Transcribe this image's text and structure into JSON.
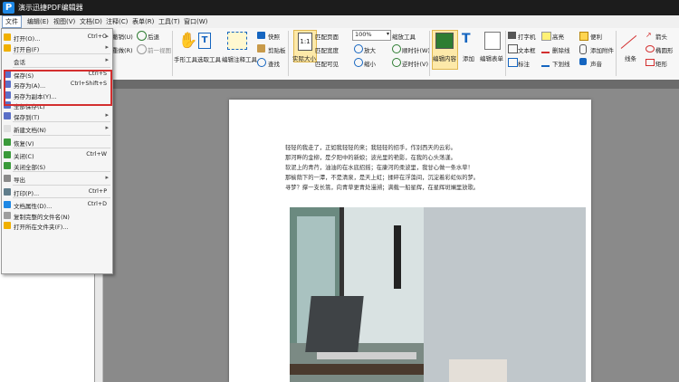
{
  "titlebar": {
    "logo": "P",
    "title": "演示迅捷PDF编辑器"
  },
  "menubar": [
    "文件",
    "编辑(E)",
    "视图(V)",
    "文档(D)",
    "注释(C)",
    "表单(R)",
    "工具(T)",
    "窗口(W)"
  ],
  "ribbon": {
    "undo": "撤销(U)",
    "redo": "重做(R)",
    "back": "后退",
    "prev_view": "前一视图",
    "hand": "手形工具",
    "select": "选取工具",
    "edit_annot": "编辑注释工具",
    "snapshot": "快照",
    "clipboard": "剪贴板",
    "find": "查找",
    "actual_size": "实际大小",
    "fit_page": "匹配页面",
    "fit_width": "匹配宽度",
    "fit_visible": "匹配可见",
    "zoom_value": "100%",
    "zoom_tool": "缩放工具",
    "zoom_in": "放大",
    "zoom_out": "缩小",
    "rotate_cw": "顺时针(W)",
    "rotate_ccw": "逆时针(V)",
    "edit_content": "编辑内容",
    "add": "添加",
    "edit_form": "编辑表单",
    "typewriter": "打字机",
    "textbox": "文本框",
    "callout": "标注",
    "highlight": "高亮",
    "strike": "删除线",
    "underline": "下划线",
    "note": "便利",
    "attach": "添加附件",
    "sound": "声音",
    "line": "线条",
    "arrow": "箭头",
    "ellipse": "椭圆形",
    "rect": "矩形"
  },
  "file_menu": [
    {
      "label": "打开(O)...",
      "shortcut": "Ctrl+O",
      "arrow": "▸",
      "icon": "#f0b000"
    },
    {
      "label": "打开自(F)",
      "shortcut": "",
      "arrow": "▸",
      "icon": "#f0b000"
    },
    {
      "sep": true
    },
    {
      "label": "会话",
      "shortcut": "",
      "arrow": "▸",
      "icon": ""
    },
    {
      "sep": true
    },
    {
      "label": "保存(S)",
      "shortcut": "Ctrl+S",
      "arrow": "",
      "icon": "#5b6fc7"
    },
    {
      "label": "另存为(A)...",
      "shortcut": "Ctrl+Shift+S",
      "arrow": "",
      "icon": "#5b6fc7"
    },
    {
      "label": "另存为副本(Y)...",
      "shortcut": "",
      "arrow": "",
      "icon": "#5b6fc7"
    },
    {
      "label": "全部保存(L)",
      "shortcut": "",
      "arrow": "",
      "icon": "#5b6fc7"
    },
    {
      "label": "保存到(T)",
      "shortcut": "",
      "arrow": "▸",
      "icon": "#5b6fc7"
    },
    {
      "sep": true
    },
    {
      "label": "新建文档(N)",
      "shortcut": "",
      "arrow": "▸",
      "icon": "#e0e0e0"
    },
    {
      "sep": true
    },
    {
      "label": "恢复(V)",
      "shortcut": "",
      "arrow": "",
      "icon": "#3a9a3a"
    },
    {
      "sep": true
    },
    {
      "label": "关闭(C)",
      "shortcut": "Ctrl+W",
      "arrow": "",
      "icon": "#3a9a3a"
    },
    {
      "label": "关闭全部(S)",
      "shortcut": "",
      "arrow": "",
      "icon": "#3a9a3a"
    },
    {
      "sep": true
    },
    {
      "label": "导出",
      "shortcut": "",
      "arrow": "▸",
      "icon": "#8a8a8a"
    },
    {
      "sep": true
    },
    {
      "label": "打印(P)...",
      "shortcut": "Ctrl+P",
      "arrow": "",
      "icon": "#607d8b"
    },
    {
      "sep": true
    },
    {
      "label": "文档属性(D)...",
      "shortcut": "Ctrl+D",
      "arrow": "",
      "icon": "#1e88e5"
    },
    {
      "label": "复制完整的文件名(N)",
      "shortcut": "",
      "arrow": "",
      "icon": "#9e9e9e"
    },
    {
      "label": "打开所在文件夹(F)...",
      "shortcut": "",
      "arrow": "",
      "icon": "#f0b000"
    }
  ],
  "document": {
    "lines": [
      "轻轻的我走了，正如我轻轻的来；我轻轻的招手，作别西天的云彩。",
      "那河畔的金柳，是夕阳中的新娘；波光里的艳影，在我的心头荡漾。",
      "软泥上的青荇，油油的在水底招摇；在康河的柔波里，我甘心做一条水草！",
      "那榆荫下的一潭，不是清泉，是天上虹；揉碎在浮藻间，沉淀着彩虹似的梦。",
      "寻梦？撑一支长篙，向青草更青处漫溯；满载一船星辉，在星辉斑斓里放歌。"
    ]
  },
  "colors": {
    "highlight_box": "#d32f2f",
    "menu_active_border": "#7a9cc6",
    "titlebar": "#1c1c1c"
  }
}
